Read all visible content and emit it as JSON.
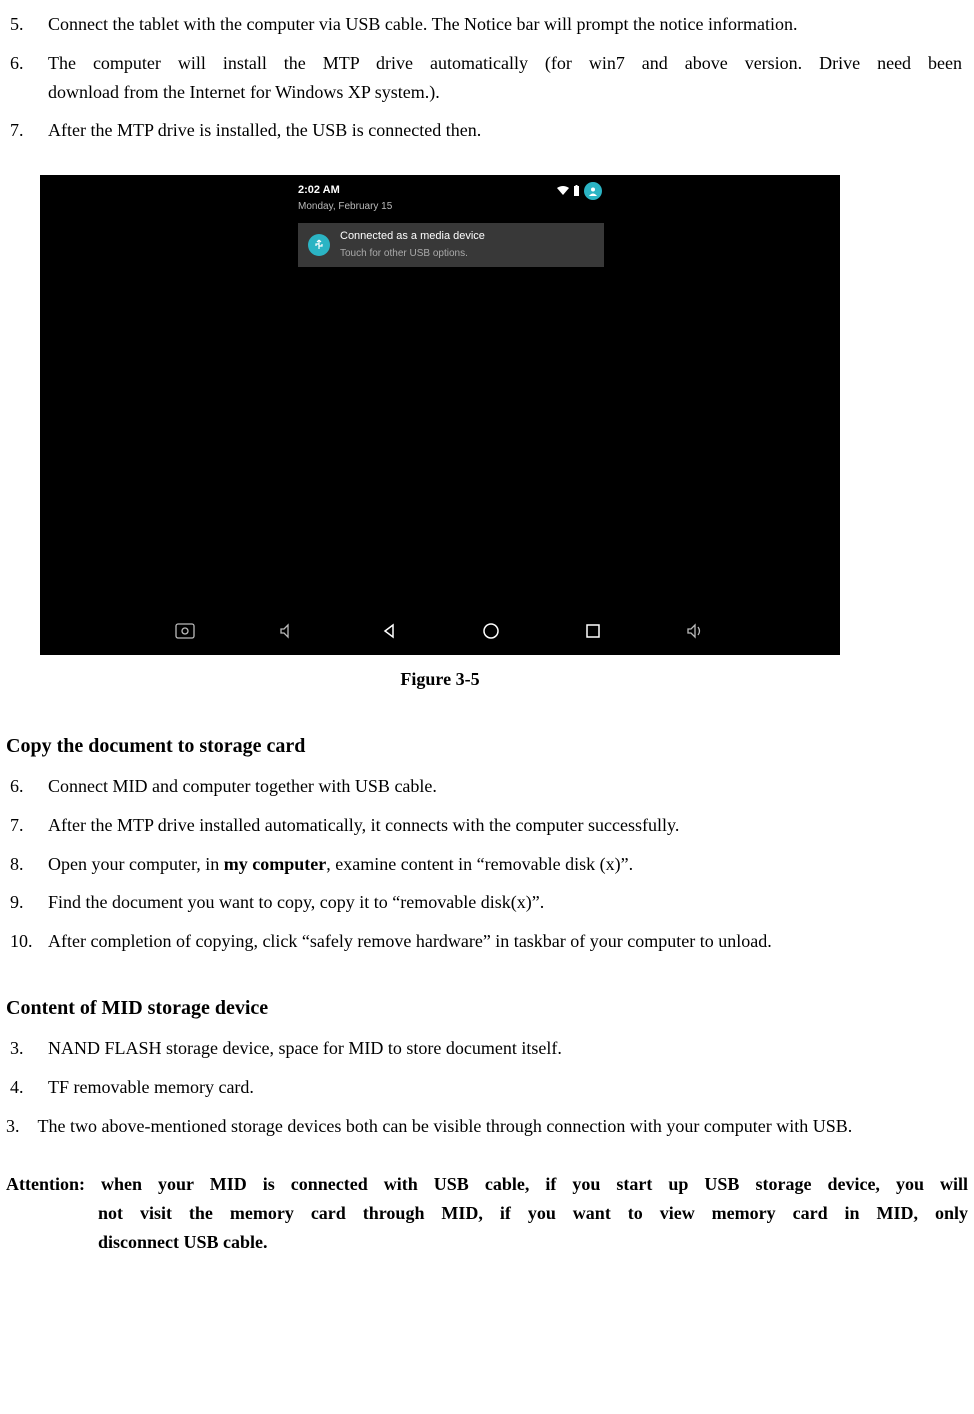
{
  "list1": [
    {
      "n": "5.",
      "t": "Connect the tablet with the computer via USB cable. The Notice bar will prompt the notice information."
    },
    {
      "n": "6.",
      "t1": "The computer will install the MTP drive automatically (for win7 and above version. Drive need been",
      "t2": "download from the Internet for Windows XP system.)."
    },
    {
      "n": "7.",
      "t": "After the MTP drive is installed, the USB is connected then."
    }
  ],
  "screenshot": {
    "time": "2:02 AM",
    "date": "Monday, February 15",
    "notif_title": "Connected as a media device",
    "notif_sub": "Touch for other USB options."
  },
  "figure_caption": "Figure 3-5",
  "section2_title": "Copy the document to storage card",
  "list2": [
    {
      "n": "6.",
      "t": "Connect MID and computer together with USB cable."
    },
    {
      "n": "7.",
      "t": "After the MTP drive installed automatically, it connects with the computer successfully."
    },
    {
      "n": "8.",
      "pre": "Open your computer, in ",
      "bold": "my computer",
      "post": ", examine content in “removable disk (x)”."
    },
    {
      "n": "9.",
      "t": "Find the document you want to copy, copy it to “removable disk(x)”."
    },
    {
      "n": "10.",
      "t": "After completion of copying, click “safely remove hardware” in taskbar of your computer to unload."
    }
  ],
  "section3_title": "Content of MID storage device",
  "list3": [
    {
      "n": "3.",
      "t": "NAND FLASH storage device, space for MID to store document itself."
    },
    {
      "n": "4.",
      "t": "TF removable memory card."
    }
  ],
  "para3": "3. The two above-mentioned storage devices both can be visible through connection with your computer with USB.",
  "attention_line1": "Attention: when your MID is connected with USB cable, if you start up USB storage device, you will",
  "attention_line2": "not visit the memory card through MID, if you want to view memory card in MID, only",
  "attention_line3": "disconnect USB cable."
}
